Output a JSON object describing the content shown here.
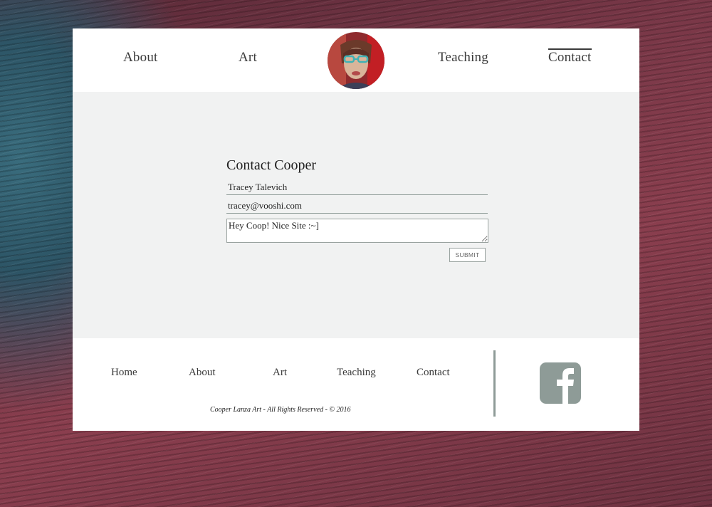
{
  "header": {
    "nav": {
      "about": "About",
      "art": "Art",
      "teaching": "Teaching",
      "contact": "Contact"
    },
    "active_nav": "Contact"
  },
  "contact_form": {
    "title": "Contact Cooper",
    "name_value": "Tracey Talevich",
    "email_value": "tracey@vooshi.com",
    "message_value": "Hey Coop! Nice Site :~]",
    "submit_label": "SUBMIT"
  },
  "footer": {
    "links": {
      "home": "Home",
      "about": "About",
      "art": "Art",
      "teaching": "Teaching",
      "contact": "Contact"
    },
    "copyright": "Cooper Lanza Art - All Rights Reserved - © 2016",
    "social_icon": "facebook-icon"
  },
  "colors": {
    "card_bg": "#ffffff",
    "content_bg": "#f1f2f2",
    "accent_gray": "#8e9b97",
    "text_dark": "#3a3a3a"
  }
}
